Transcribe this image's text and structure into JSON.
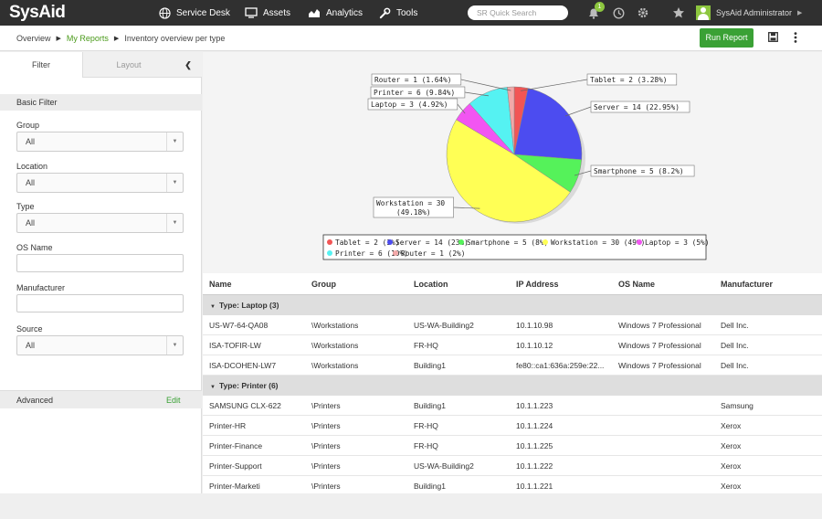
{
  "app": {
    "logo": "SysAid"
  },
  "topnav": {
    "items": [
      {
        "label": "Service Desk",
        "icon": "globe-icon"
      },
      {
        "label": "Assets",
        "icon": "monitor-icon"
      },
      {
        "label": "Analytics",
        "icon": "chart-icon"
      },
      {
        "label": "Tools",
        "icon": "wrench-icon"
      }
    ],
    "search_placeholder": "SR Quick Search",
    "notification_count": "1",
    "user_name": "SysAid Administrator"
  },
  "breadcrumb": {
    "items": [
      "Overview",
      "My Reports",
      "Inventory overview per type"
    ],
    "run_report": "Run Report"
  },
  "sidebar": {
    "tabs": [
      "Filter",
      "Layout"
    ],
    "basic_filter": "Basic Filter",
    "fields": [
      {
        "label": "Group",
        "value": "All",
        "kind": "select"
      },
      {
        "label": "Location",
        "value": "All",
        "kind": "select"
      },
      {
        "label": "Type",
        "value": "All",
        "kind": "select"
      },
      {
        "label": "OS Name",
        "value": "",
        "kind": "input"
      },
      {
        "label": "Manufacturer",
        "value": "",
        "kind": "input"
      },
      {
        "label": "Source",
        "value": "All",
        "kind": "select"
      }
    ],
    "advanced": "Advanced",
    "edit": "Edit"
  },
  "chart_data": {
    "type": "pie",
    "slices": [
      {
        "name": "Tablet",
        "value": 2,
        "callout": "Tablet = 2 (3.28%)",
        "legend": "Tablet = 2 (3%)",
        "color": "#f25555"
      },
      {
        "name": "Server",
        "value": 14,
        "callout": "Server = 14 (22.95%)",
        "legend": "Server = 14 (23%)",
        "color": "#4c4cf0"
      },
      {
        "name": "Smartphone",
        "value": 5,
        "callout": "Smartphone = 5 (8.2%)",
        "legend": "Smartphone = 5 (8%)",
        "color": "#55f25a"
      },
      {
        "name": "Workstation",
        "value": 30,
        "callout": "Workstation = 30|(49.18%)",
        "legend": "Workstation = 30 (49%)",
        "color": "#ffff55"
      },
      {
        "name": "Laptop",
        "value": 3,
        "callout": "Laptop = 3 (4.92%)",
        "legend": "Laptop = 3 (5%)",
        "color": "#f255f2"
      },
      {
        "name": "Printer",
        "value": 6,
        "callout": "Printer = 6 (9.84%)",
        "legend": "Printer = 6 (10%)",
        "color": "#55f2f2"
      },
      {
        "name": "Router",
        "value": 1,
        "callout": "Router = 1 (1.64%)",
        "legend": "Router = 1 (2%)",
        "color": "#f2a8a8"
      }
    ],
    "legend_placement": "bottom"
  },
  "table": {
    "columns": [
      "Name",
      "Group",
      "Location",
      "IP Address",
      "OS Name",
      "Manufacturer"
    ],
    "groups": [
      {
        "title": "Type: Laptop (3)",
        "rows": [
          [
            "US-W7-64-QA08",
            "\\Workstations",
            "US-WA-Building2",
            "10.1.10.98",
            "Windows 7 Professional",
            "Dell Inc."
          ],
          [
            "ISA-TOFIR-LW",
            "\\Workstations",
            "FR-HQ",
            "10.1.10.12",
            "Windows 7 Professional",
            "Dell Inc."
          ],
          [
            "ISA-DCOHEN-LW7",
            "\\Workstations",
            "Building1",
            "fe80::ca1:636a:259e:22...",
            "Windows 7 Professional",
            "Dell Inc."
          ]
        ]
      },
      {
        "title": "Type: Printer (6)",
        "rows": [
          [
            "SAMSUNG CLX-622",
            "\\Printers",
            "Building1",
            "10.1.1.223",
            "",
            "Samsung"
          ],
          [
            "Printer-HR",
            "\\Printers",
            "FR-HQ",
            "10.1.1.224",
            "",
            "Xerox"
          ],
          [
            "Printer-Finance",
            "\\Printers",
            "FR-HQ",
            "10.1.1.225",
            "",
            "Xerox"
          ],
          [
            "Printer-Support",
            "\\Printers",
            "US-WA-Building2",
            "10.1.1.222",
            "",
            "Xerox"
          ],
          [
            "Printer-Marketi",
            "\\Printers",
            "Building1",
            "10.1.1.221",
            "",
            "Xerox"
          ]
        ]
      }
    ]
  }
}
